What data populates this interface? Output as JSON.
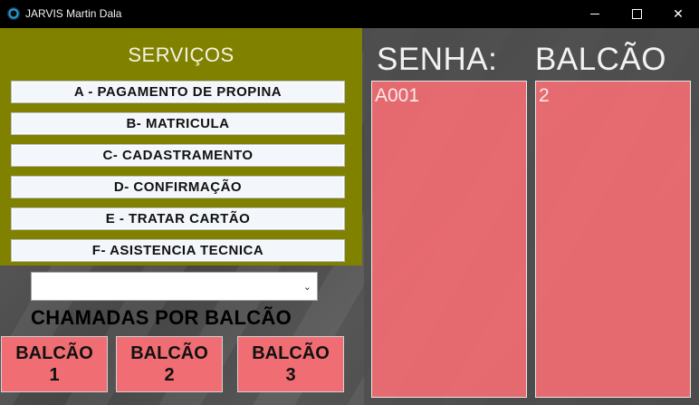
{
  "window": {
    "title": "JARVIS Martin Dala",
    "icon": "app-eye-icon"
  },
  "services": {
    "title": "SERVIÇOS",
    "items": [
      {
        "label": "A - PAGAMENTO DE PROPINA"
      },
      {
        "label": "B- MATRICULA"
      },
      {
        "label": "C- CADASTRAMENTO"
      },
      {
        "label": "D- CONFIRMAÇÃO"
      },
      {
        "label": "E - TRATAR CARTÃO"
      },
      {
        "label": "F- ASISTENCIA TECNICA"
      }
    ]
  },
  "combo": {
    "value": ""
  },
  "calls": {
    "title": "CHAMADAS POR BALCÃO",
    "buttons": [
      {
        "line1": "BALCÃO",
        "line2": "1"
      },
      {
        "line1": "BALCÃO",
        "line2": "2"
      },
      {
        "line1": "BALCÃO",
        "line2": "3"
      }
    ]
  },
  "board": {
    "senha_header": "SENHA:",
    "balcao_header": "BALCÃO",
    "senha_value": "A001",
    "balcao_value": "2"
  },
  "colors": {
    "services_bg": "#818100",
    "accent_red": "#f06e73"
  }
}
